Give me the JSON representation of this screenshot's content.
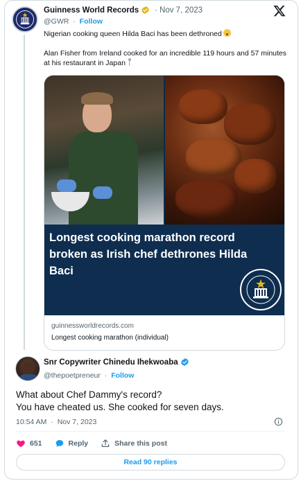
{
  "tweet": {
    "author_name": "Guinness World Records",
    "date": "Nov 7, 2023",
    "handle": "@GWR",
    "follow_label": "Follow",
    "line1": "Nigerian cooking queen Hilda Baci has been dethroned",
    "line2": "Alan Fisher from Ireland cooked for an incredible 119 hours and 57 minutes at his restaurant in Japan",
    "icons": {
      "verified": "gold-verified-badge-icon",
      "platform": "x-logo-icon",
      "emoji": "flushed-face-emoji-icon",
      "pin": "round-pushpin-icon"
    }
  },
  "card": {
    "headline": "Longest cooking marathon record broken as Irish chef dethrones Hilda Baci",
    "domain": "guinnessworldrecords.com",
    "title": "Longest cooking marathon (individual)"
  },
  "reply": {
    "author_name": "Snr Copywriter Chinedu Ihekwoaba",
    "handle": "@thepoetpreneur",
    "follow_label": "Follow",
    "text_line1": "What about Chef Dammy's record?",
    "text_line2": "You have cheated us. She cooked for seven days.",
    "time": "10:54 AM",
    "date": "Nov 7, 2023",
    "icons": {
      "verified": "blue-verified-badge-icon",
      "info": "info-circle-icon"
    }
  },
  "actions": {
    "like_count": "651",
    "reply_label": "Reply",
    "share_label": "Share this post",
    "read_replies_label": "Read 90 replies"
  },
  "colors": {
    "accent": "#1d9bf0",
    "like": "#f91880",
    "headline_band": "#0f2d4f",
    "gold_badge": "#e2b719"
  }
}
